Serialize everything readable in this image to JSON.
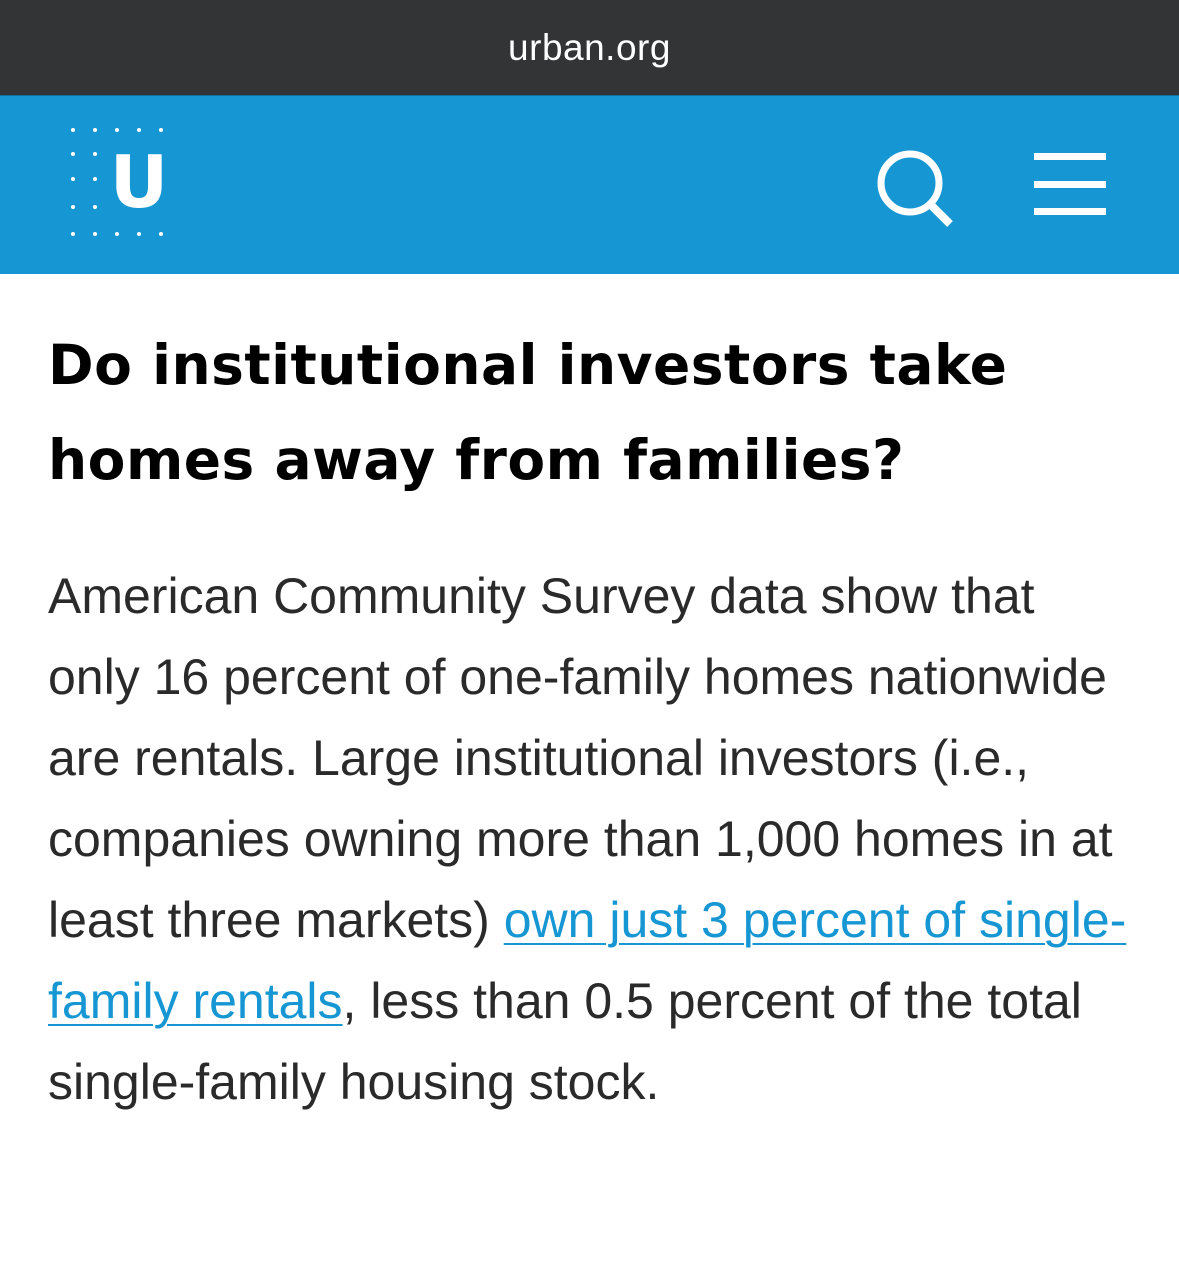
{
  "browser": {
    "url": "urban.org"
  },
  "header": {
    "logo_letter": "U",
    "logo_icon": "urban-institute-logo",
    "search_icon": "search-icon",
    "menu_icon": "hamburger-menu-icon",
    "background_color": "#1696d2"
  },
  "article": {
    "title": "Do institutional investors take homes away from families?",
    "body_before_link": "American Community Survey data show that only 16 percent of one-family homes nationwide are rentals. Large institutional investors (i.e., companies owning more than 1,000 homes in at least three markets) ",
    "link_text": "own just 3 percent of single-family rentals",
    "body_after_link": ", less than 0.5 percent of the total single-family housing stock.",
    "link_color": "#1696d2"
  }
}
